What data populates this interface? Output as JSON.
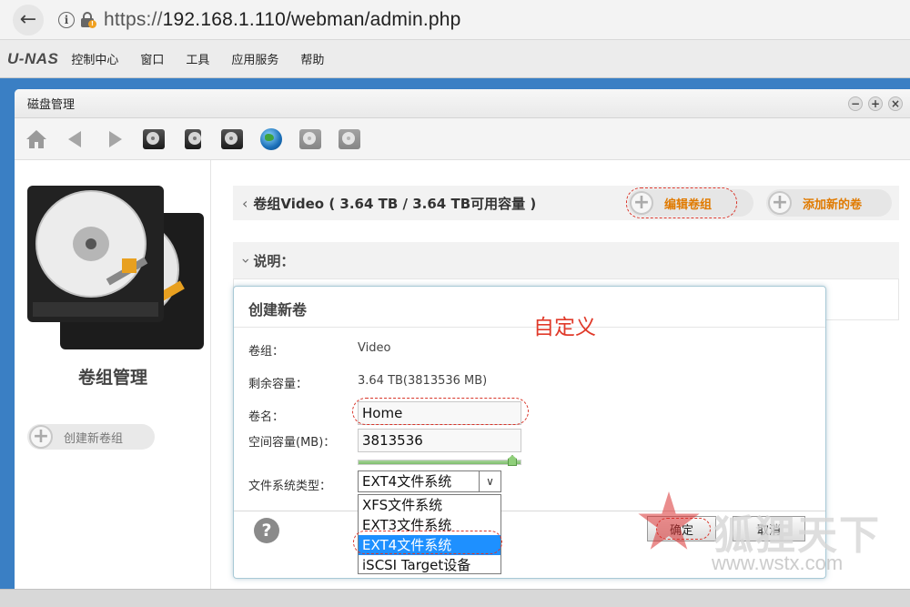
{
  "browser": {
    "url_scheme": "https://",
    "url_rest": "192.168.1.110/webman/admin.php"
  },
  "nas": {
    "logo": "U-NAS",
    "menu": [
      "控制中心",
      "窗口",
      "工具",
      "应用服务",
      "帮助"
    ]
  },
  "window": {
    "title": "磁盘管理",
    "controls": [
      "−",
      "+",
      "×"
    ]
  },
  "left": {
    "title": "卷组管理",
    "create_vg": "创建新卷组"
  },
  "volume_group": {
    "header": "卷组Video ( 3.64 TB / 3.64 TB可用容量 )",
    "edit_btn": "编辑卷组",
    "add_btn": "添加新的卷",
    "desc_label": "说明："
  },
  "dialog": {
    "title": "创建新卷",
    "vg_label": "卷组：",
    "vg_value": "Video",
    "remaining_label": "剩余容量：",
    "remaining_value": "3.64 TB(3813536 MB)",
    "name_label": "卷名：",
    "name_value": "Home",
    "size_label": "空间容量(MB)：",
    "size_value": "3813536",
    "size_fraction": 1.0,
    "fs_label": "文件系统类型：",
    "fs_selected": "EXT4文件系统",
    "fs_options": [
      "XFS文件系统",
      "EXT3文件系统",
      "EXT4文件系统",
      "iSCSI Target设备"
    ],
    "fs_highlighted": 2,
    "ok": "确定",
    "cancel": "取消"
  },
  "annotation": "自定义",
  "watermark": {
    "text": "狐狸天下",
    "url": "www.wstx.com"
  },
  "colors": {
    "accent_orange": "#e07a00",
    "annotation_red": "#e03a2a",
    "select_blue": "#1e90ff",
    "desktop_blue": "#3a7fc4"
  }
}
